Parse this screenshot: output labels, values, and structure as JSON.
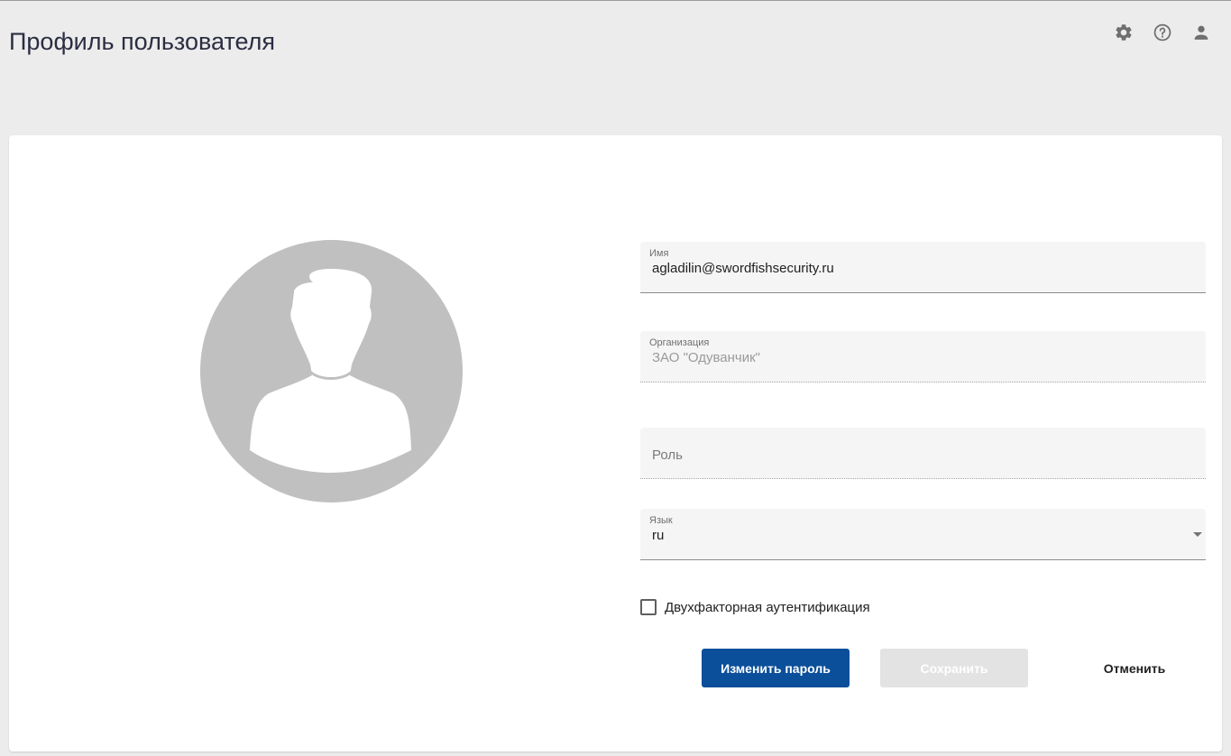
{
  "header": {
    "title": "Профиль пользователя",
    "icons": [
      "gear-icon",
      "help-icon",
      "person-icon"
    ]
  },
  "profile": {
    "name": {
      "label": "Имя",
      "value": "agladilin@swordfishsecurity.ru"
    },
    "organization": {
      "label": "Организация",
      "value": "ЗАО \"Одуванчик\""
    },
    "role": {
      "placeholder": "Роль"
    },
    "language": {
      "label": "Язык",
      "value": "ru"
    },
    "two_factor": {
      "label": "Двухфакторная аутентификация",
      "checked": false
    }
  },
  "actions": {
    "change_password": "Изменить пароль",
    "save": "Сохранить",
    "cancel": "Отменить"
  },
  "colors": {
    "primary": "#0b4f9b",
    "disabled_button": "#e3e3e3",
    "avatar": "#c0c0c0",
    "background": "#ececec"
  }
}
